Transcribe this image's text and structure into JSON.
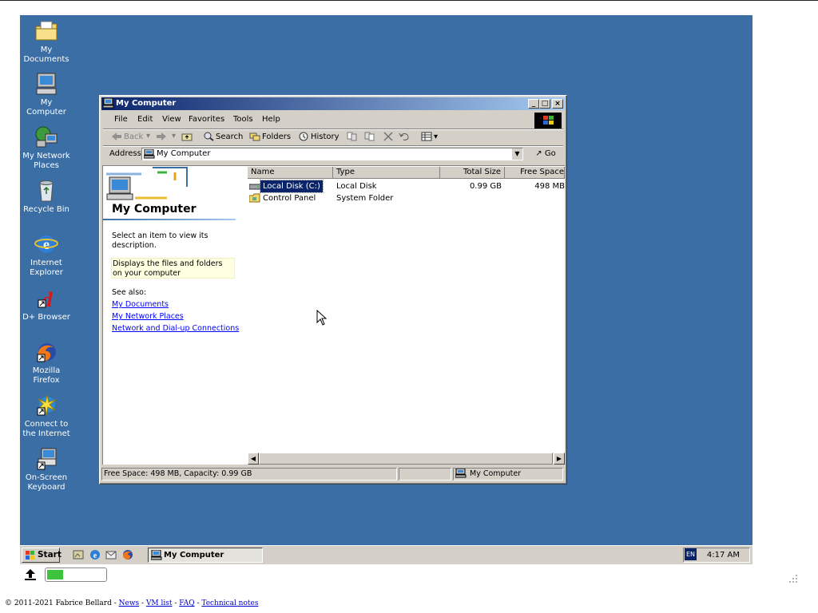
{
  "desktop": {
    "background": "#3a6ea5",
    "icons": [
      {
        "label": "My Documents",
        "icon": "folder-documents-icon"
      },
      {
        "label": "My Computer",
        "icon": "computer-icon"
      },
      {
        "label": "My Network Places",
        "icon": "network-icon"
      },
      {
        "label": "Recycle Bin",
        "icon": "recycle-bin-icon"
      },
      {
        "label": "Internet Explorer",
        "icon": "ie-icon"
      },
      {
        "label": "D+ Browser",
        "icon": "dplus-icon"
      },
      {
        "label": "Mozilla Firefox",
        "icon": "firefox-icon"
      },
      {
        "label": "Connect to the Internet",
        "icon": "connect-icon"
      },
      {
        "label": "On-Screen Keyboard",
        "icon": "keyboard-icon"
      }
    ]
  },
  "window": {
    "title": "My Computer",
    "controls": {
      "minimize": "_",
      "maximize": "□",
      "close": "×"
    },
    "menu": [
      "File",
      "Edit",
      "View",
      "Favorites",
      "Tools",
      "Help"
    ],
    "toolbar": {
      "back": "Back",
      "search": "Search",
      "folders": "Folders",
      "history": "History"
    },
    "address": {
      "label": "Address",
      "value": "My Computer",
      "go": "Go"
    },
    "left_pane": {
      "title": "My Computer",
      "prompt": "Select an item to view its description.",
      "highlight": "Displays the files and folders on your computer",
      "see_also": "See also:",
      "links": [
        "My Documents",
        "My Network Places",
        "Network and Dial-up Connections"
      ]
    },
    "columns": [
      "Name",
      "Type",
      "Total Size",
      "Free Space"
    ],
    "rows": [
      {
        "name": "Local Disk (C:)",
        "type": "Local Disk",
        "total": "0.99 GB",
        "free": "498 MB",
        "icon": "drive-icon",
        "selected": true
      },
      {
        "name": "Control Panel",
        "type": "System Folder",
        "total": "",
        "free": "",
        "icon": "control-panel-icon",
        "selected": false
      }
    ],
    "status": {
      "left": "Free Space: 498 MB, Capacity: 0.99 GB",
      "right": "My Computer"
    }
  },
  "taskbar": {
    "start": "Start",
    "task": "My Computer",
    "lang": "EN",
    "time": "4:17 AM"
  },
  "page": {
    "progress": 0.28,
    "footer": {
      "copyright": "© 2011-2021 Fabrice Bellard - ",
      "links": [
        "News",
        "VM list",
        "FAQ",
        "Technical notes"
      ]
    }
  }
}
